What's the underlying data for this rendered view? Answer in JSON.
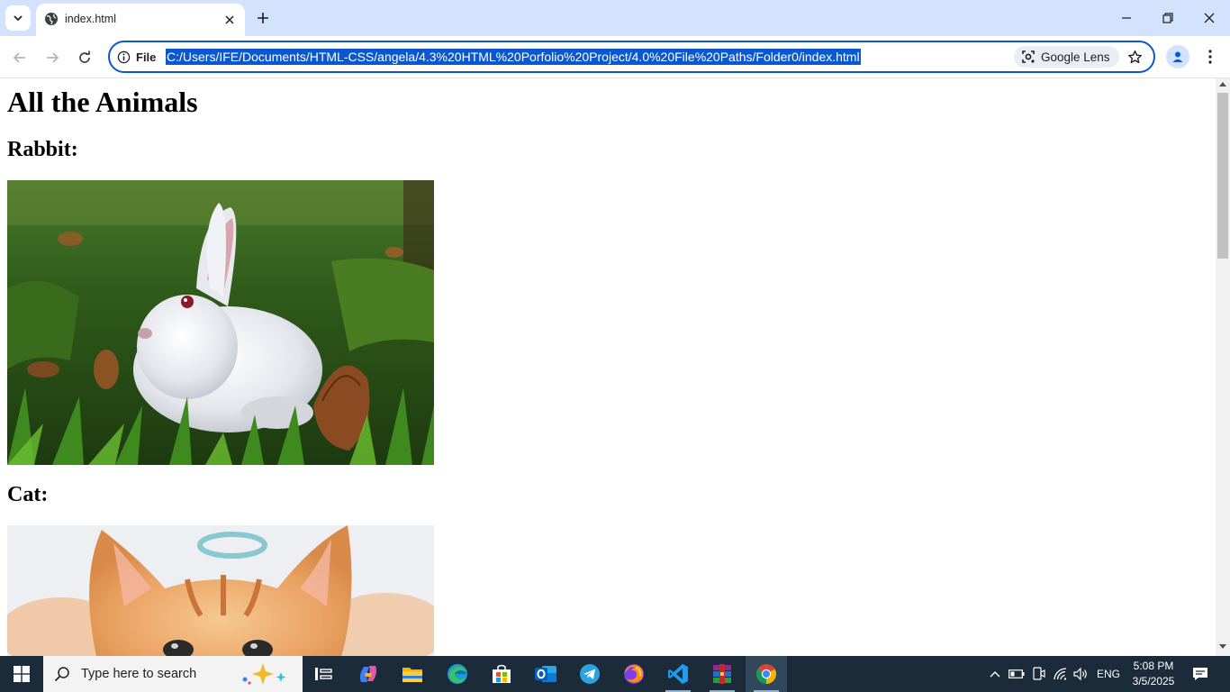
{
  "browser": {
    "tab": {
      "title": "index.html"
    },
    "address": {
      "site_label": "File",
      "url": "C:/Users/IFE/Documents/HTML-CSS/angela/4.3%20HTML%20Porfolio%20Project/4.0%20File%20Paths/Folder0/index.html",
      "lens_label": "Google Lens"
    },
    "accent_color": "#0b57d0",
    "tabstrip_color": "#d3e3fd"
  },
  "page": {
    "heading": "All the Animals",
    "sections": [
      {
        "title": "Rabbit:",
        "image": "white rabbit sitting in green grass"
      },
      {
        "title": "Cat:",
        "image": "orange tabby kitten"
      }
    ]
  },
  "taskbar": {
    "search_placeholder": "Type here to search",
    "apps": [
      "task-view",
      "copilot",
      "file-explorer",
      "edge",
      "microsoft-store",
      "outlook",
      "telegram",
      "firefox",
      "vs-code",
      "winrar",
      "chrome"
    ],
    "tray": {
      "language": "ENG",
      "time": "5:08 PM",
      "date": "3/5/2025"
    }
  }
}
